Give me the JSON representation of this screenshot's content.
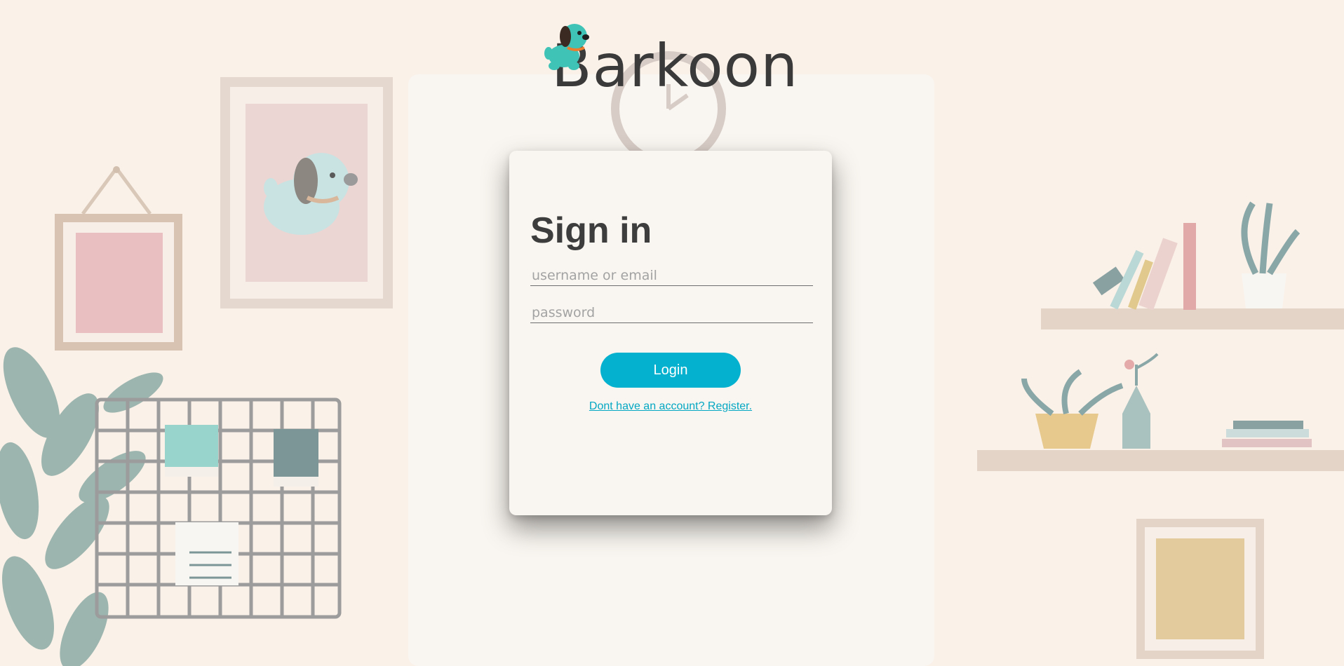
{
  "brand": {
    "name": "Barkoon",
    "logo_icon": "puppy-icon"
  },
  "signin": {
    "title": "Sign in",
    "username_placeholder": "username or email",
    "username_value": "",
    "password_placeholder": "password",
    "password_value": "",
    "login_label": "Login",
    "register_link": "Dont have an account? Register."
  },
  "colors": {
    "accent": "#04b1ce",
    "background": "#faf1e8",
    "card": "#f9f6f1",
    "title_text": "#3d3d3d"
  }
}
